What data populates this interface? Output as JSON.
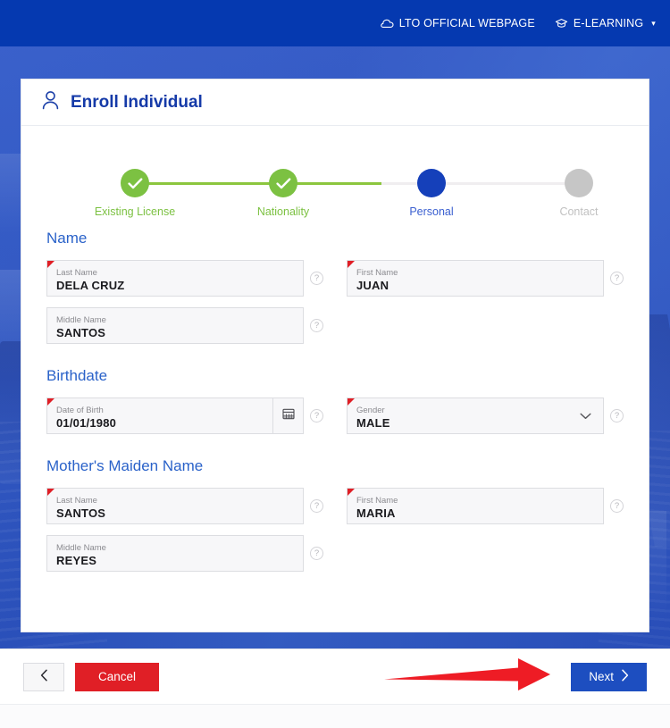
{
  "topbar": {
    "links": [
      {
        "icon": "cloud-icon",
        "label": "LTO OFFICIAL WEBPAGE"
      },
      {
        "icon": "graduation-cap-icon",
        "label": "E-LEARNING",
        "caret": "▾"
      }
    ]
  },
  "card": {
    "title": "Enroll Individual",
    "title_icon": "person-icon"
  },
  "stepper": {
    "steps": [
      {
        "label": "Existing License",
        "state": "done"
      },
      {
        "label": "Nationality",
        "state": "done"
      },
      {
        "label": "Personal",
        "state": "active"
      },
      {
        "label": "Contact",
        "state": "todo"
      }
    ]
  },
  "sections": [
    {
      "title": "Name",
      "fields": [
        {
          "label": "Last Name",
          "value": "DELA CRUZ",
          "required": true,
          "help": "?"
        },
        {
          "label": "First Name",
          "value": "JUAN",
          "required": true,
          "help": "?"
        },
        {
          "label": "Middle Name",
          "value": "SANTOS",
          "required": false,
          "help": "?"
        }
      ]
    },
    {
      "title": "Birthdate",
      "fields": [
        {
          "label": "Date of Birth",
          "value": "01/01/1980",
          "required": true,
          "help": "?",
          "addon": "calendar-icon"
        },
        {
          "label": "Gender",
          "value": "MALE",
          "required": true,
          "help": "?",
          "addon": "chevron-down-icon"
        }
      ]
    },
    {
      "title": "Mother's Maiden Name",
      "fields": [
        {
          "label": "Last Name",
          "value": "SANTOS",
          "required": true,
          "help": "?"
        },
        {
          "label": "First Name",
          "value": "MARIA",
          "required": true,
          "help": "?"
        },
        {
          "label": "Middle Name",
          "value": "REYES",
          "required": false,
          "help": "?"
        }
      ]
    }
  ],
  "footer": {
    "back_icon": "chevron-left-icon",
    "cancel_label": "Cancel",
    "next_label": "Next",
    "next_icon": "chevron-right-icon"
  },
  "annotation": {
    "type": "arrow",
    "color": "#ee1c25",
    "points_to": "next-button"
  },
  "colors": {
    "header_blue": "#0539b0",
    "primary_blue": "#1d4ec0",
    "title_blue": "#153aa8",
    "section_blue": "#2a62c9",
    "step_done_green": "#7cc142",
    "step_todo_grey": "#c6c6c6",
    "danger_red": "#e01f26",
    "required_marker_red": "#e01f26",
    "annotation_red": "#ee1c25",
    "field_bg": "#f7f7f9",
    "field_border": "#dcdde1"
  }
}
